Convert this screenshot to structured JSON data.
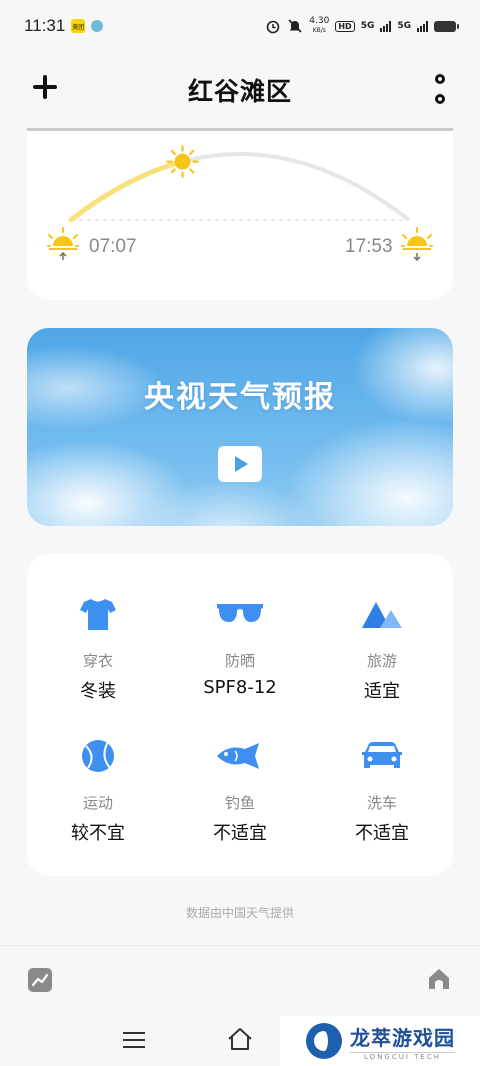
{
  "status_bar": {
    "time": "11:31",
    "app_badge": "美团",
    "net_speed_value": "4.30",
    "net_speed_unit": "KB/s",
    "hd": "HD",
    "signal1": "5G",
    "signal2": "5G"
  },
  "header": {
    "title": "红谷滩区"
  },
  "sun": {
    "sunrise": "07:07",
    "sunset": "17:53",
    "progress": 0.33,
    "colors": {
      "done": "#f9e07a",
      "remaining": "#e6e6e6",
      "sun": "#f5c518"
    }
  },
  "video": {
    "title": "央视天气预报"
  },
  "life_indices": [
    {
      "icon": "tshirt-icon",
      "label": "穿衣",
      "value": "冬装"
    },
    {
      "icon": "sunglasses-icon",
      "label": "防晒",
      "value": "SPF8-12"
    },
    {
      "icon": "mountain-icon",
      "label": "旅游",
      "value": "适宜"
    },
    {
      "icon": "tennis-ball-icon",
      "label": "运动",
      "value": "较不宜"
    },
    {
      "icon": "fish-icon",
      "label": "钓鱼",
      "value": "不适宜"
    },
    {
      "icon": "car-icon",
      "label": "洗车",
      "value": "不适宜"
    }
  ],
  "footnote": "数据由中国天气提供",
  "watermark": {
    "name": "龙萃游戏园",
    "sub": "LONGCUI TECH"
  },
  "accent_color": "#3d8ff0"
}
